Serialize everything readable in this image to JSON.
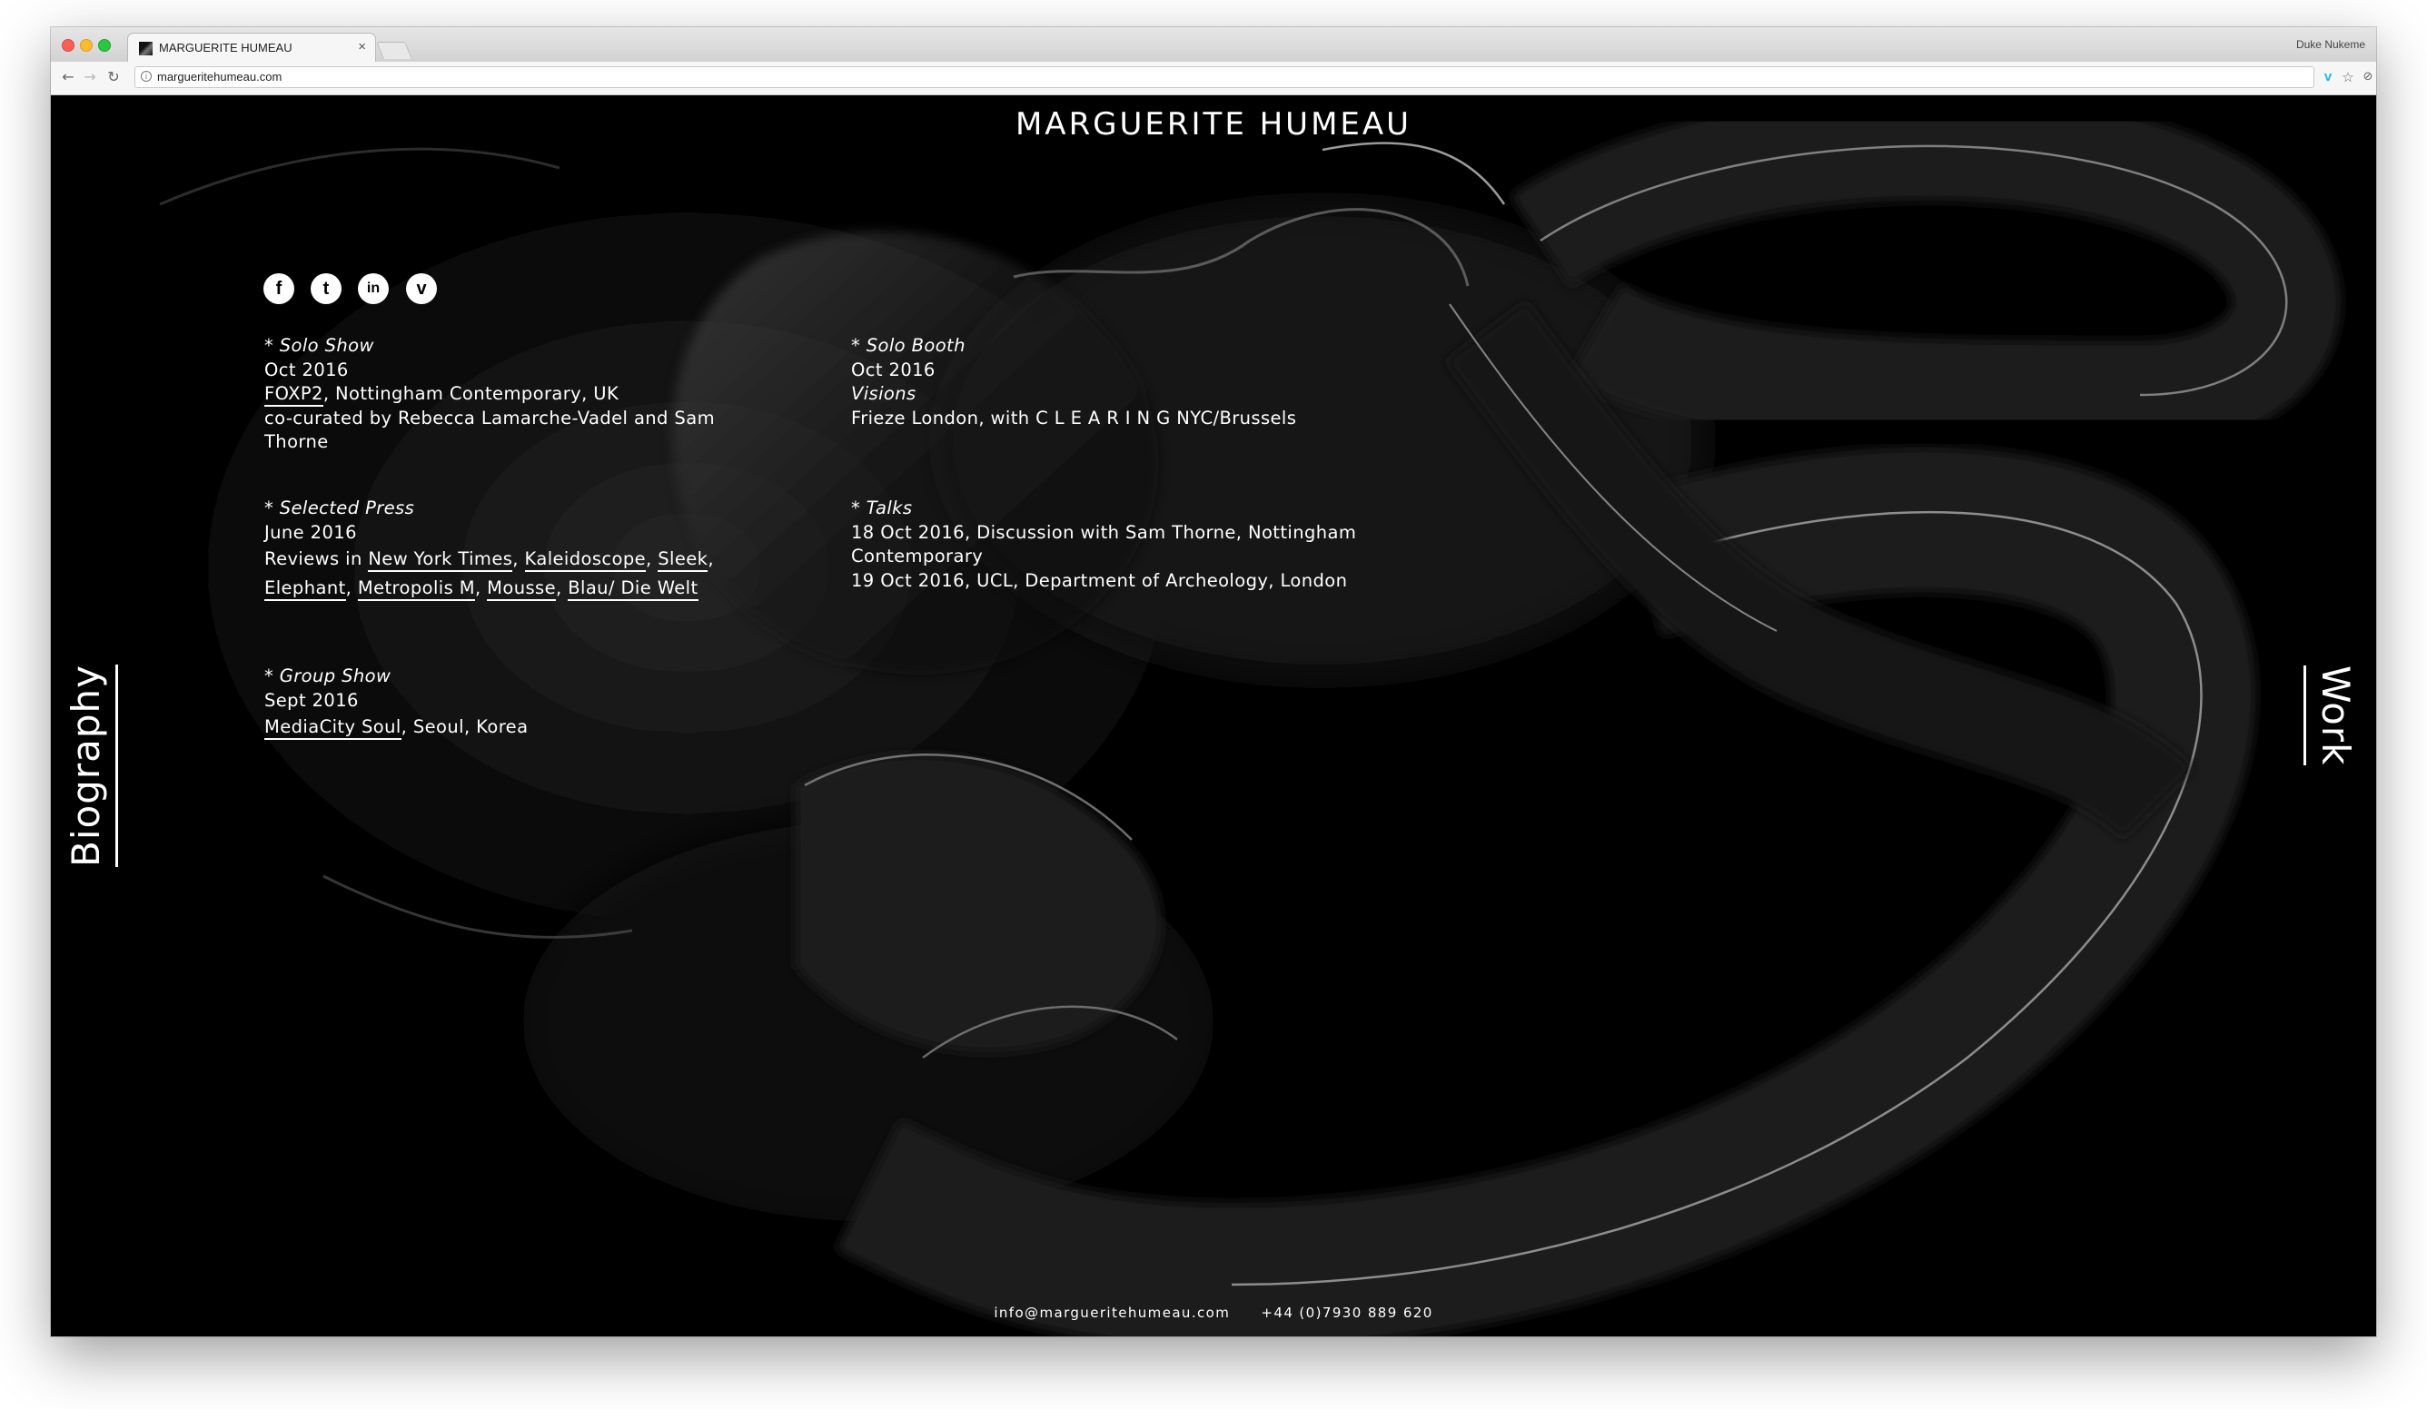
{
  "browser": {
    "tab_title": "MARGUERITE HUMEAU",
    "tab_close": "×",
    "url": "margueritehumeau.com",
    "profile_name": "Duke Nukeme",
    "icons": [
      "back-icon",
      "forward-icon",
      "reload-icon",
      "info-icon",
      "vimeo-extension-icon",
      "star-icon",
      "extension-icon",
      "menu-icon"
    ]
  },
  "site": {
    "title": "MARGUERITE HUMEAU",
    "social": [
      {
        "name": "facebook-icon",
        "glyph": "f"
      },
      {
        "name": "twitter-icon",
        "glyph": "t"
      },
      {
        "name": "linkedin-icon",
        "glyph": "in"
      },
      {
        "name": "vimeo-icon",
        "glyph": "v"
      }
    ],
    "left_column": {
      "solo_show": {
        "heading": "* Solo Show",
        "date": "Oct 2016",
        "link": "FOXP2",
        "venue": ", Nottingham Contemporary, UK",
        "curated_line1": "co-curated by Rebecca Lamarche-Vadel and Sam",
        "curated_line2": "Thorne"
      },
      "selected_press": {
        "heading": "* Selected Press",
        "date": "June 2016",
        "intro": "Reviews in ",
        "links": [
          "New York Times",
          "Kaleidoscope",
          "Sleek",
          "Elephant",
          "Metropolis M",
          "Mousse",
          "Blau/ Die Welt"
        ]
      },
      "group_show": {
        "heading": "* Group Show",
        "date": "Sept 2016",
        "link": "MediaCity Soul",
        "location": ", Seoul, Korea"
      }
    },
    "right_column": {
      "solo_booth": {
        "heading": "* Solo Booth",
        "date": "Oct 2016",
        "title": "Visions",
        "line": "Frieze London, with C L E A R I N G NYC/Brussels"
      },
      "talks": {
        "heading": "* Talks",
        "line1": "18 Oct 2016, Discussion with Sam Thorne, Nottingham",
        "line2": "Contemporary",
        "line3": "19 Oct 2016, UCL, Department of Archeology, London"
      }
    },
    "nav": {
      "biography": "Biography",
      "work": "Work"
    },
    "footer": {
      "email": "info@margueritehumeau.com",
      "phone": "+44 (0)7930 889 620"
    }
  }
}
